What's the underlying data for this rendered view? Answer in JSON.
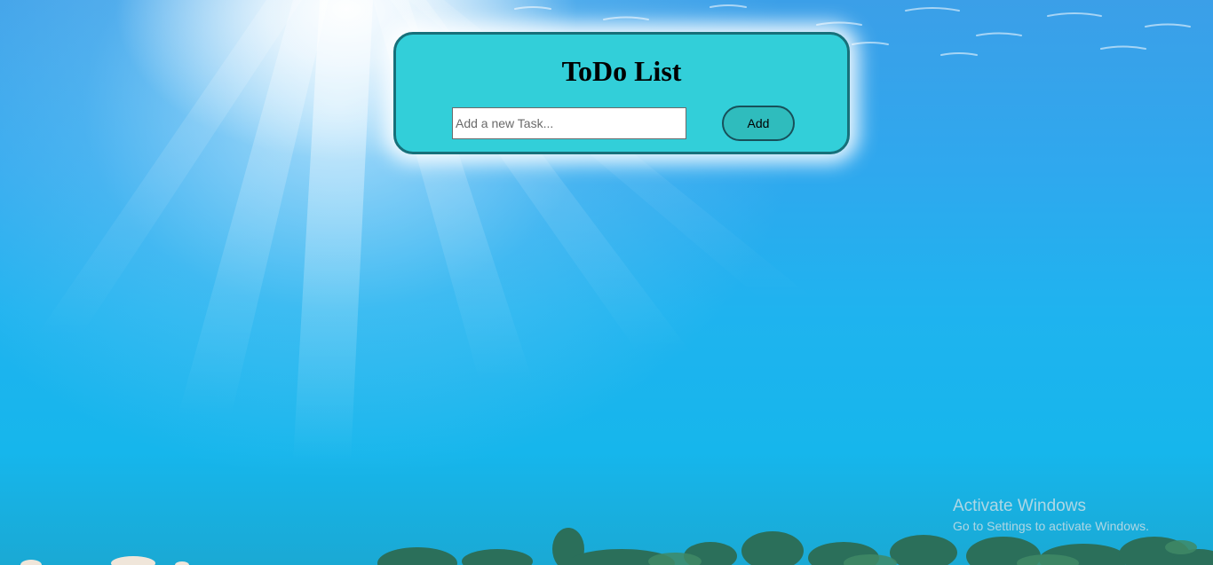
{
  "todo": {
    "title": "ToDo List",
    "input_placeholder": "Add a new Task...",
    "input_value": "",
    "add_button_label": "Add"
  },
  "os_watermark": {
    "title": "Activate Windows",
    "subtitle": "Go to Settings to activate Windows."
  },
  "colors": {
    "card_background": "#32cfd9",
    "card_border": "#17707a",
    "button_background": "#2fbcbd",
    "button_border": "#17505a"
  }
}
